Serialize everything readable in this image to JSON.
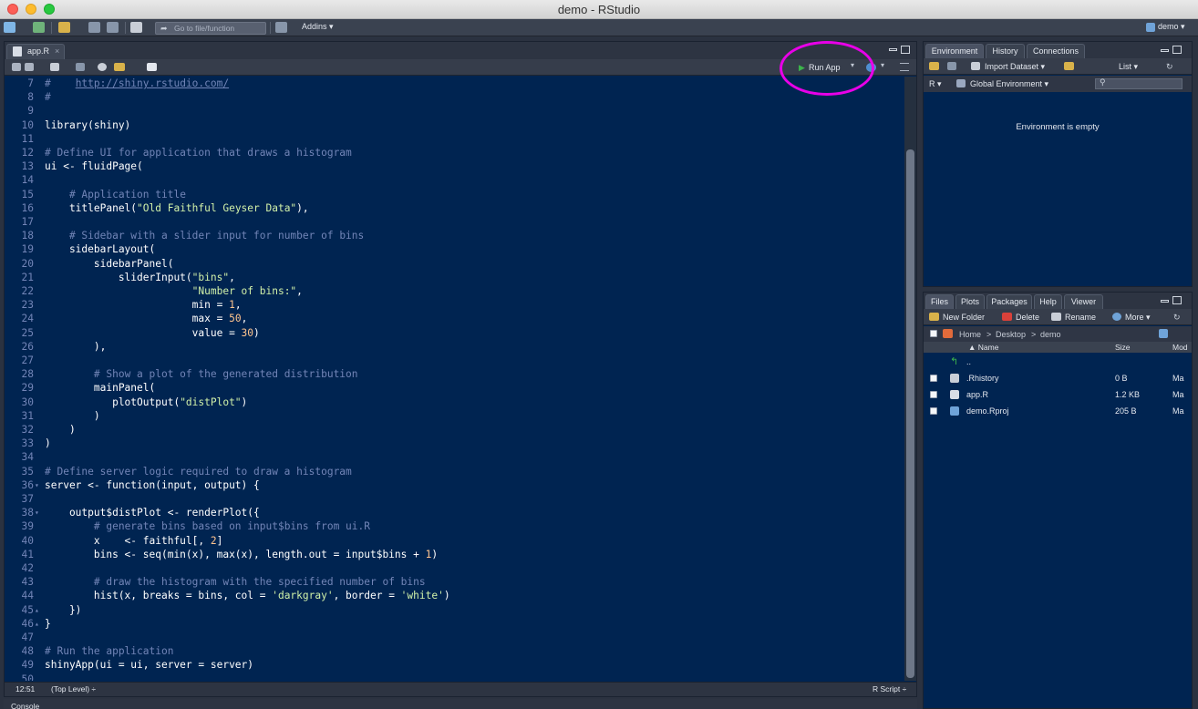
{
  "window": {
    "title": "demo - RStudio"
  },
  "main_toolbar": {
    "goto_placeholder": "Go to file/function",
    "addins_label": "Addins",
    "project_label": "demo"
  },
  "editor": {
    "tab_label": "app.R",
    "tab_close": "×",
    "run_app_label": "Run App",
    "lines": [
      {
        "n": "7",
        "fold": "",
        "parts": [
          {
            "t": "#    ",
            "c": "comment"
          },
          {
            "t": "http://shiny.rstudio.com/",
            "c": "url"
          }
        ]
      },
      {
        "n": "8",
        "fold": "",
        "parts": [
          {
            "t": "#",
            "c": "comment"
          }
        ]
      },
      {
        "n": "9",
        "fold": "",
        "parts": []
      },
      {
        "n": "10",
        "fold": "",
        "parts": [
          {
            "t": "library(shiny)",
            "c": ""
          }
        ]
      },
      {
        "n": "11",
        "fold": "",
        "parts": []
      },
      {
        "n": "12",
        "fold": "",
        "parts": [
          {
            "t": "# Define UI for application that draws a histogram",
            "c": "comment"
          }
        ]
      },
      {
        "n": "13",
        "fold": "",
        "parts": [
          {
            "t": "ui <- fluidPage(",
            "c": ""
          }
        ]
      },
      {
        "n": "14",
        "fold": "",
        "parts": []
      },
      {
        "n": "15",
        "fold": "",
        "parts": [
          {
            "t": "    ",
            "c": ""
          },
          {
            "t": "# Application title",
            "c": "comment"
          }
        ]
      },
      {
        "n": "16",
        "fold": "",
        "parts": [
          {
            "t": "    titlePanel(",
            "c": ""
          },
          {
            "t": "\"Old Faithful Geyser Data\"",
            "c": "str"
          },
          {
            "t": "),",
            "c": ""
          }
        ]
      },
      {
        "n": "17",
        "fold": "",
        "parts": []
      },
      {
        "n": "18",
        "fold": "",
        "parts": [
          {
            "t": "    ",
            "c": ""
          },
          {
            "t": "# Sidebar with a slider input for number of bins",
            "c": "comment"
          }
        ]
      },
      {
        "n": "19",
        "fold": "",
        "parts": [
          {
            "t": "    sidebarLayout(",
            "c": ""
          }
        ]
      },
      {
        "n": "20",
        "fold": "",
        "parts": [
          {
            "t": "        sidebarPanel(",
            "c": ""
          }
        ]
      },
      {
        "n": "21",
        "fold": "",
        "parts": [
          {
            "t": "            sliderInput(",
            "c": ""
          },
          {
            "t": "\"bins\"",
            "c": "str"
          },
          {
            "t": ",",
            "c": ""
          }
        ]
      },
      {
        "n": "22",
        "fold": "",
        "parts": [
          {
            "t": "                        ",
            "c": ""
          },
          {
            "t": "\"Number of bins:\"",
            "c": "str"
          },
          {
            "t": ",",
            "c": ""
          }
        ]
      },
      {
        "n": "23",
        "fold": "",
        "parts": [
          {
            "t": "                        min = ",
            "c": ""
          },
          {
            "t": "1",
            "c": "num"
          },
          {
            "t": ",",
            "c": ""
          }
        ]
      },
      {
        "n": "24",
        "fold": "",
        "parts": [
          {
            "t": "                        max = ",
            "c": ""
          },
          {
            "t": "50",
            "c": "num"
          },
          {
            "t": ",",
            "c": ""
          }
        ]
      },
      {
        "n": "25",
        "fold": "",
        "parts": [
          {
            "t": "                        value = ",
            "c": ""
          },
          {
            "t": "30",
            "c": "num"
          },
          {
            "t": ")",
            "c": ""
          }
        ]
      },
      {
        "n": "26",
        "fold": "",
        "parts": [
          {
            "t": "        ),",
            "c": ""
          }
        ]
      },
      {
        "n": "27",
        "fold": "",
        "parts": []
      },
      {
        "n": "28",
        "fold": "",
        "parts": [
          {
            "t": "        ",
            "c": ""
          },
          {
            "t": "# Show a plot of the generated distribution",
            "c": "comment"
          }
        ]
      },
      {
        "n": "29",
        "fold": "",
        "parts": [
          {
            "t": "        mainPanel(",
            "c": ""
          }
        ]
      },
      {
        "n": "30",
        "fold": "",
        "parts": [
          {
            "t": "           plotOutput(",
            "c": ""
          },
          {
            "t": "\"distPlot\"",
            "c": "str"
          },
          {
            "t": ")",
            "c": ""
          }
        ]
      },
      {
        "n": "31",
        "fold": "",
        "parts": [
          {
            "t": "        )",
            "c": ""
          }
        ]
      },
      {
        "n": "32",
        "fold": "",
        "parts": [
          {
            "t": "    )",
            "c": ""
          }
        ]
      },
      {
        "n": "33",
        "fold": "",
        "parts": [
          {
            "t": ")",
            "c": ""
          }
        ]
      },
      {
        "n": "34",
        "fold": "",
        "parts": []
      },
      {
        "n": "35",
        "fold": "",
        "parts": [
          {
            "t": "# Define server logic required to draw a histogram",
            "c": "comment"
          }
        ]
      },
      {
        "n": "36",
        "fold": "▾",
        "parts": [
          {
            "t": "server <- function(input, output) {",
            "c": ""
          }
        ]
      },
      {
        "n": "37",
        "fold": "",
        "parts": []
      },
      {
        "n": "38",
        "fold": "▾",
        "parts": [
          {
            "t": "    output$distPlot <- renderPlot({",
            "c": ""
          }
        ]
      },
      {
        "n": "39",
        "fold": "",
        "parts": [
          {
            "t": "        ",
            "c": ""
          },
          {
            "t": "# generate bins based on input$bins from ui.R",
            "c": "comment"
          }
        ]
      },
      {
        "n": "40",
        "fold": "",
        "parts": [
          {
            "t": "        x    <- faithful[, ",
            "c": ""
          },
          {
            "t": "2",
            "c": "num"
          },
          {
            "t": "]",
            "c": ""
          }
        ]
      },
      {
        "n": "41",
        "fold": "",
        "parts": [
          {
            "t": "        bins <- seq(min(x), max(x), length.out = input$bins + ",
            "c": ""
          },
          {
            "t": "1",
            "c": "num"
          },
          {
            "t": ")",
            "c": ""
          }
        ]
      },
      {
        "n": "42",
        "fold": "",
        "parts": []
      },
      {
        "n": "43",
        "fold": "",
        "parts": [
          {
            "t": "        ",
            "c": ""
          },
          {
            "t": "# draw the histogram with the specified number of bins",
            "c": "comment"
          }
        ]
      },
      {
        "n": "44",
        "fold": "",
        "parts": [
          {
            "t": "        hist(x, breaks = bins, col = ",
            "c": ""
          },
          {
            "t": "'darkgray'",
            "c": "str"
          },
          {
            "t": ", border = ",
            "c": ""
          },
          {
            "t": "'white'",
            "c": "str"
          },
          {
            "t": ")",
            "c": ""
          }
        ]
      },
      {
        "n": "45",
        "fold": "▴",
        "parts": [
          {
            "t": "    })",
            "c": ""
          }
        ]
      },
      {
        "n": "46",
        "fold": "▴",
        "parts": [
          {
            "t": "}",
            "c": ""
          }
        ]
      },
      {
        "n": "47",
        "fold": "",
        "parts": []
      },
      {
        "n": "48",
        "fold": "",
        "parts": [
          {
            "t": "# Run the application",
            "c": "comment"
          }
        ]
      },
      {
        "n": "49",
        "fold": "",
        "parts": [
          {
            "t": "shinyApp(ui = ui, server = server)",
            "c": ""
          }
        ]
      },
      {
        "n": "50",
        "fold": "",
        "parts": []
      }
    ],
    "status": {
      "cursor": "12:51",
      "scope": "(Top Level) ÷",
      "file_type": "R Script ÷"
    }
  },
  "console": {
    "label": "Console"
  },
  "environment": {
    "tabs": [
      "Environment",
      "History",
      "Connections"
    ],
    "import_label": "Import Dataset ▾",
    "list_label": "List ▾",
    "lang_label": "R ▾",
    "scope_label": "Global Environment ▾",
    "empty_text": "Environment is empty"
  },
  "files": {
    "tabs": [
      "Files",
      "Plots",
      "Packages",
      "Help",
      "Viewer"
    ],
    "toolbar": {
      "new_folder": "New Folder",
      "delete": "Delete",
      "rename": "Rename",
      "more": "More ▾"
    },
    "path": [
      "Home",
      "Desktop",
      "demo"
    ],
    "path_sep": ">",
    "columns": {
      "name": "▲ Name",
      "size": "Size",
      "modified": "Mod"
    },
    "up_label": "..",
    "rows": [
      {
        "name": ".Rhistory",
        "size": "0 B",
        "modified": "Ma"
      },
      {
        "name": "app.R",
        "size": "1.2 KB",
        "modified": "Ma"
      },
      {
        "name": "demo.Rproj",
        "size": "205 B",
        "modified": "Ma"
      }
    ]
  },
  "colors": {
    "editor_bg": "#002451",
    "comment": "#7285b7",
    "string": "#d1f1a9",
    "number": "#ffc58f",
    "highlight_circle": "#e800e8"
  }
}
